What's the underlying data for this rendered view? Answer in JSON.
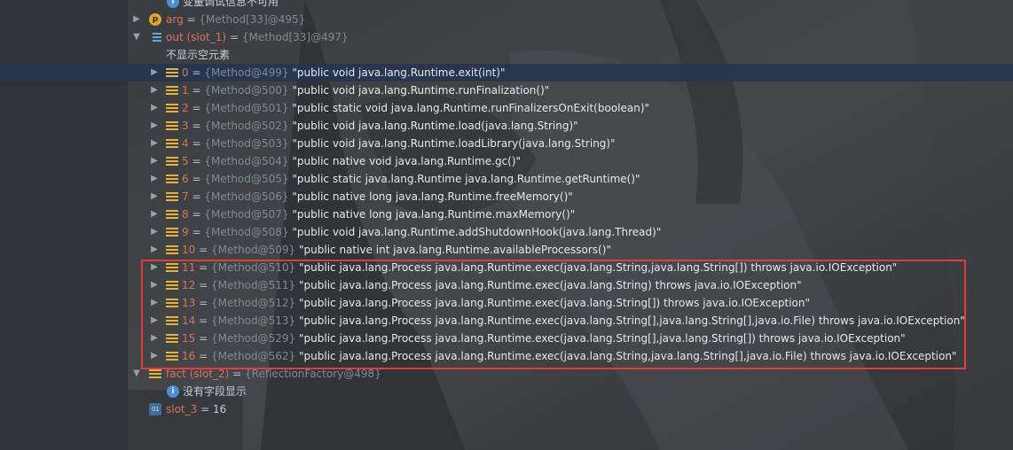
{
  "top_note": "变量调试信息不可用",
  "arg": {
    "name": "arg",
    "value": "{Method[33]@495}"
  },
  "out": {
    "name": "out (slot_1)",
    "value": "{Method[33]@497}",
    "empty_note": "不显示空元素",
    "items": [
      {
        "index": "0",
        "ref": "{Method@499}",
        "sig": "\"public void java.lang.Runtime.exit(int)\""
      },
      {
        "index": "1",
        "ref": "{Method@500}",
        "sig": "\"public void java.lang.Runtime.runFinalization()\""
      },
      {
        "index": "2",
        "ref": "{Method@501}",
        "sig": "\"public static void java.lang.Runtime.runFinalizersOnExit(boolean)\""
      },
      {
        "index": "3",
        "ref": "{Method@502}",
        "sig": "\"public void java.lang.Runtime.load(java.lang.String)\""
      },
      {
        "index": "4",
        "ref": "{Method@503}",
        "sig": "\"public void java.lang.Runtime.loadLibrary(java.lang.String)\""
      },
      {
        "index": "5",
        "ref": "{Method@504}",
        "sig": "\"public native void java.lang.Runtime.gc()\""
      },
      {
        "index": "6",
        "ref": "{Method@505}",
        "sig": "\"public static java.lang.Runtime java.lang.Runtime.getRuntime()\""
      },
      {
        "index": "7",
        "ref": "{Method@506}",
        "sig": "\"public native long java.lang.Runtime.freeMemory()\""
      },
      {
        "index": "8",
        "ref": "{Method@507}",
        "sig": "\"public native long java.lang.Runtime.maxMemory()\""
      },
      {
        "index": "9",
        "ref": "{Method@508}",
        "sig": "\"public void java.lang.Runtime.addShutdownHook(java.lang.Thread)\""
      },
      {
        "index": "10",
        "ref": "{Method@509}",
        "sig": "\"public native int java.lang.Runtime.availableProcessors()\""
      },
      {
        "index": "11",
        "ref": "{Method@510}",
        "sig": "\"public java.lang.Process java.lang.Runtime.exec(java.lang.String,java.lang.String[]) throws java.io.IOException\""
      },
      {
        "index": "12",
        "ref": "{Method@511}",
        "sig": "\"public java.lang.Process java.lang.Runtime.exec(java.lang.String) throws java.io.IOException\""
      },
      {
        "index": "13",
        "ref": "{Method@512}",
        "sig": "\"public java.lang.Process java.lang.Runtime.exec(java.lang.String[]) throws java.io.IOException\""
      },
      {
        "index": "14",
        "ref": "{Method@513}",
        "sig": "\"public java.lang.Process java.lang.Runtime.exec(java.lang.String[],java.lang.String[],java.io.File) throws java.io.IOException\""
      },
      {
        "index": "15",
        "ref": "{Method@529}",
        "sig": "\"public java.lang.Process java.lang.Runtime.exec(java.lang.String[],java.lang.String[]) throws java.io.IOException\""
      },
      {
        "index": "16",
        "ref": "{Method@562}",
        "sig": "\"public java.lang.Process java.lang.Runtime.exec(java.lang.String,java.lang.String[],java.io.File) throws java.io.IOException\""
      }
    ]
  },
  "fact": {
    "name": "fact (slot_2)",
    "value": "{ReflectionFactory@498}",
    "note": "没有字段显示"
  },
  "slot3": {
    "name": "slot_3",
    "value": "16"
  },
  "eq": "=",
  "colors": {
    "highlight": "#e23b3b",
    "selected_row": "#25364e",
    "var_name": "#d8735f"
  },
  "icons": {
    "expand": "chevron-right-icon",
    "collapse": "chevron-down-icon"
  }
}
